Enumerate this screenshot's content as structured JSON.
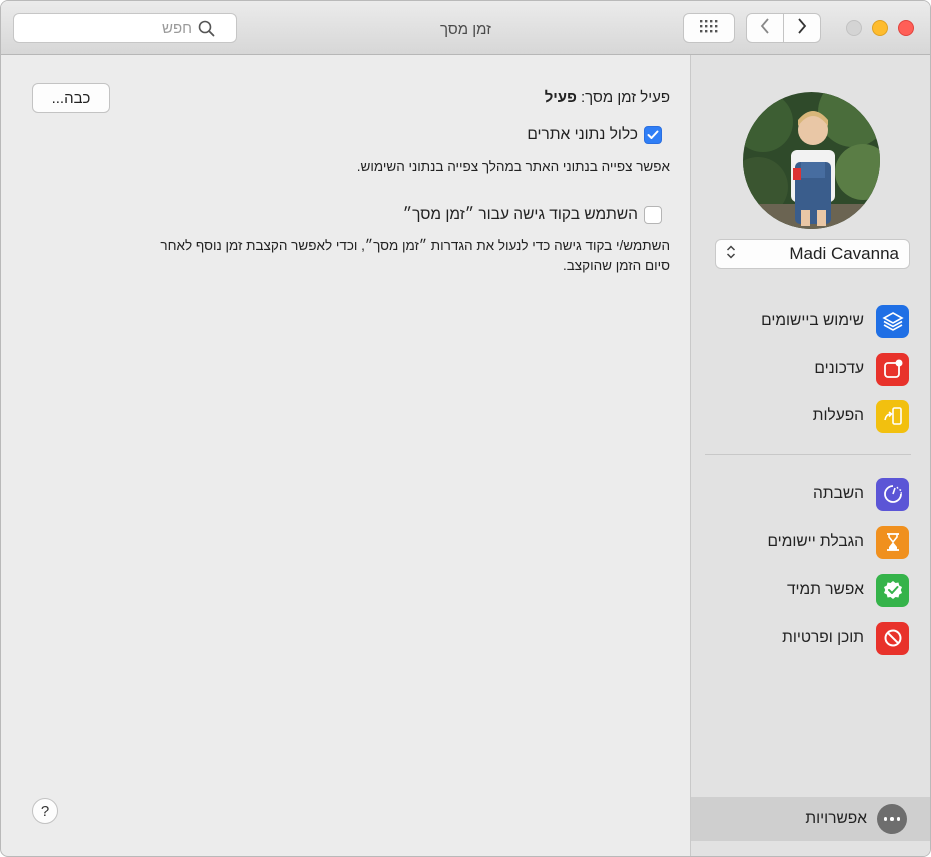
{
  "window": {
    "title": "זמן מסך"
  },
  "toolbar": {
    "search_placeholder": "חפש",
    "icons": [
      "grid-icon",
      "chevron-left-icon",
      "chevron-right-icon",
      "search-icon"
    ]
  },
  "sidebar": {
    "user_name": "Madi Cavanna",
    "group1": [
      {
        "label": "שימוש ביישומים",
        "icon": "app-usage-icon",
        "color": "#1f6fe5"
      },
      {
        "label": "עדכונים",
        "icon": "notifications-icon",
        "color": "#e8322b"
      },
      {
        "label": "הפעלות",
        "icon": "pickups-icon",
        "color": "#f2c00f"
      }
    ],
    "group2": [
      {
        "label": "השבתה",
        "icon": "downtime-icon",
        "color": "#5b55d6"
      },
      {
        "label": "הגבלת יישומים",
        "icon": "hourglass-icon",
        "color": "#f0901e"
      },
      {
        "label": "אפשר תמיד",
        "icon": "always-allowed-icon",
        "color": "#35b34a"
      },
      {
        "label": "תוכן ופרטיות",
        "icon": "content-privacy-icon",
        "color": "#e8322b"
      }
    ],
    "options_label": "אפשרויות"
  },
  "main": {
    "status_prefix": "פעיל זמן מסך: ",
    "status_value": "פעיל",
    "turn_off_label": "כבה...",
    "include_website_label": "כלול נתוני אתרים",
    "include_website_checked": true,
    "include_website_desc": "אפשר צפייה בנתוני האתר במהלך צפייה בנתוני השימוש.",
    "passcode_label": "השתמש בקוד גישה עבור ״זמן מסך״",
    "passcode_checked": false,
    "passcode_desc_line1": "השתמש/י בקוד גישה כדי לנעול את הגדרות ״זמן מסך״, וכדי לאפשר הקצבת זמן נוסף לאחר",
    "passcode_desc_line2": "סיום הזמן שהוקצב.",
    "help_label": "?"
  }
}
